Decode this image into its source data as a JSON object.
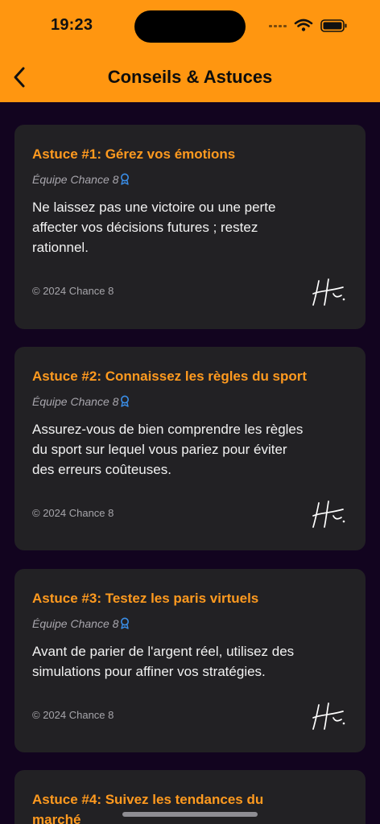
{
  "status_bar": {
    "time": "19:23"
  },
  "nav": {
    "title": "Conseils & Astuces"
  },
  "tips": [
    {
      "title": "Astuce #1: Gérez vos émotions",
      "author": "Équipe Chance 8",
      "text_lines": [
        "Ne laissez pas une victoire ou une perte",
        "affecter vos décisions futures ; restez",
        "rationnel."
      ],
      "copyright": "© 2024 Chance 8"
    },
    {
      "title": "Astuce #2: Connaissez les règles du sport",
      "author": "Équipe Chance 8",
      "text_lines": [
        "Assurez-vous de bien comprendre les règles",
        "du sport sur lequel vous pariez pour éviter",
        "des erreurs coûteuses."
      ],
      "copyright": "© 2024 Chance 8"
    },
    {
      "title": "Astuce #3: Testez les paris virtuels",
      "author": "Équipe Chance 8",
      "text_lines": [
        "Avant de parier de l'argent réel, utilisez des",
        "simulations pour affiner vos stratégies."
      ],
      "copyright": "© 2024 Chance 8"
    },
    {
      "title_lines": [
        "Astuce #4: Suivez les tendances du",
        "marché"
      ]
    }
  ],
  "colors": {
    "header": "#ff9610",
    "background": "#12041f",
    "card": "#222124",
    "accent": "#ff9a1f",
    "ribbon": "#3a8ee8"
  },
  "icons": {
    "back": "chevron-left-icon",
    "author_badge": "award-ribbon-icon",
    "signature": "signature-icon"
  }
}
